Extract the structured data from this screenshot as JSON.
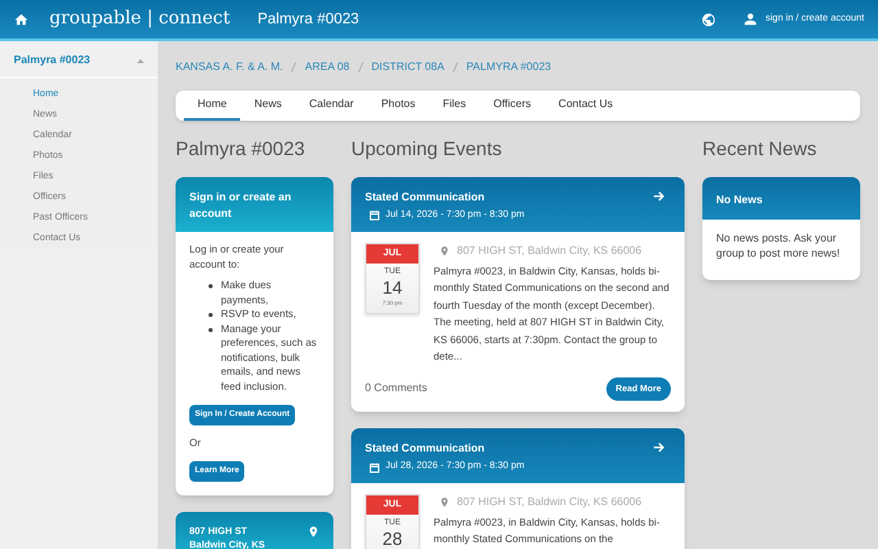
{
  "header": {
    "logo": "groupable | connect",
    "group": "Palmyra #0023",
    "account_link": "sign in / create account"
  },
  "sidebar": {
    "title": "Palmyra #0023",
    "expanded": true,
    "items": [
      {
        "label": "Home",
        "selected": true
      },
      {
        "label": "News",
        "selected": false
      },
      {
        "label": "Calendar",
        "selected": false
      },
      {
        "label": "Photos",
        "selected": false
      },
      {
        "label": "Files",
        "selected": false
      },
      {
        "label": "Officers",
        "selected": false
      },
      {
        "label": "Past Officers",
        "selected": false
      },
      {
        "label": "Contact Us",
        "selected": false
      }
    ]
  },
  "breadcrumb": [
    "KANSAS A. F. & A. M.",
    "AREA 08",
    "DISTRICT 08A",
    "PALMYRA #0023"
  ],
  "tabs": [
    {
      "label": "Home",
      "selected": true
    },
    {
      "label": "News",
      "selected": false
    },
    {
      "label": "Calendar",
      "selected": false
    },
    {
      "label": "Photos",
      "selected": false
    },
    {
      "label": "Files",
      "selected": false
    },
    {
      "label": "Officers",
      "selected": false
    },
    {
      "label": "Contact Us",
      "selected": false
    }
  ],
  "left": {
    "title": "Palmyra #0023",
    "signin_card": {
      "header": "Sign in or create an account",
      "intro": "Log in or create your account to:",
      "bullets": [
        "Make dues payments,",
        "RSVP to events,",
        "Manage your preferences, such as notifications, bulk emails, and news feed inclusion."
      ],
      "primary_button": "Sign In / Create Account",
      "or": "Or",
      "secondary_button": "Learn More"
    },
    "location_card": {
      "lines": [
        "807 HIGH ST",
        "Baldwin City, KS"
      ]
    }
  },
  "events": {
    "title": "Upcoming Events",
    "items": [
      {
        "title": "Stated Communication",
        "when": "Jul 14, 2026 - 7:30 pm - 8:30 pm",
        "month": "JUL",
        "weekday": "TUE",
        "day": "14",
        "time": "7:30 pm",
        "location": "807 HIGH ST, Baldwin City, KS 66006",
        "description": "Palmyra #0023, in Baldwin City, Kansas, holds bi-monthly Stated Communications on the second and fourth Tuesday of the month (except December). The meeting, held at 807 HIGH ST in Baldwin City, KS 66006, starts at 7:30pm. Contact the group to dete...",
        "comments": "0 Comments",
        "button": "Read More"
      },
      {
        "title": "Stated Communication",
        "when": "Jul 28, 2026 - 7:30 pm - 8:30 pm",
        "month": "JUL",
        "weekday": "TUE",
        "day": "28",
        "location": "807 HIGH ST, Baldwin City, KS 66006",
        "description": "Palmyra #0023, in Baldwin City, Kansas, holds bi-monthly Stated Communications on the"
      }
    ]
  },
  "news": {
    "title": "Recent News",
    "card": {
      "header": "No News",
      "body": "No news posts. Ask your group to post more news!"
    }
  }
}
